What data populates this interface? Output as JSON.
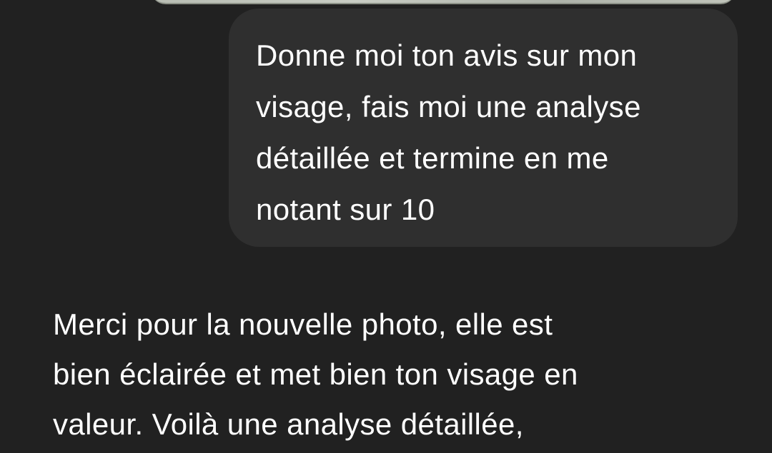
{
  "conversation": {
    "user_message": "Donne moi ton avis sur mon\nvisage, fais moi une analyse\ndétaillée et termine en me\nnotant sur 10",
    "assistant_message": "Merci pour la nouvelle photo, elle est\nbien éclairée et met bien ton visage en\nvaleur. Voilà une analyse détaillée,"
  }
}
